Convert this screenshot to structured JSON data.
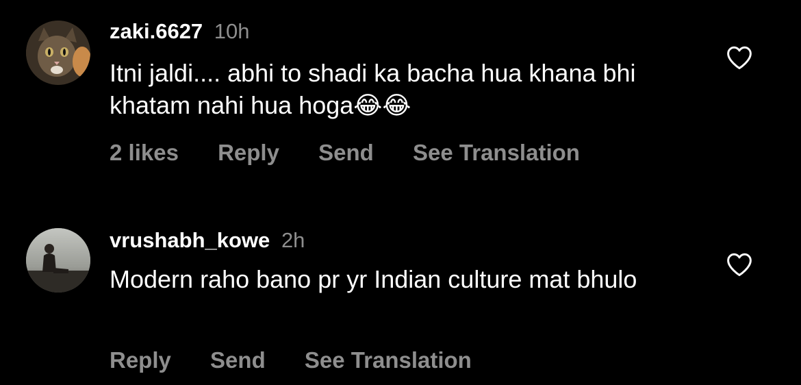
{
  "comments": [
    {
      "username": "zaki.6627",
      "time": "10h",
      "text": "Itni jaldi.... abhi to shadi ka bacha hua khana bhi khatam nahi hua hoga😂😂",
      "likes": "2 likes",
      "reply": "Reply",
      "send": "Send",
      "translate": "See Translation",
      "avatar_icon": "cat-avatar"
    },
    {
      "username": "vrushabh_kowe",
      "time": "2h",
      "text": "Modern raho bano pr yr Indian culture mat bhulo",
      "reply": "Reply",
      "send": "Send",
      "translate": "See Translation",
      "avatar_icon": "person-avatar"
    }
  ],
  "colors": {
    "background": "#000000",
    "primary_text": "#ffffff",
    "secondary_text": "#8e8e8e"
  }
}
